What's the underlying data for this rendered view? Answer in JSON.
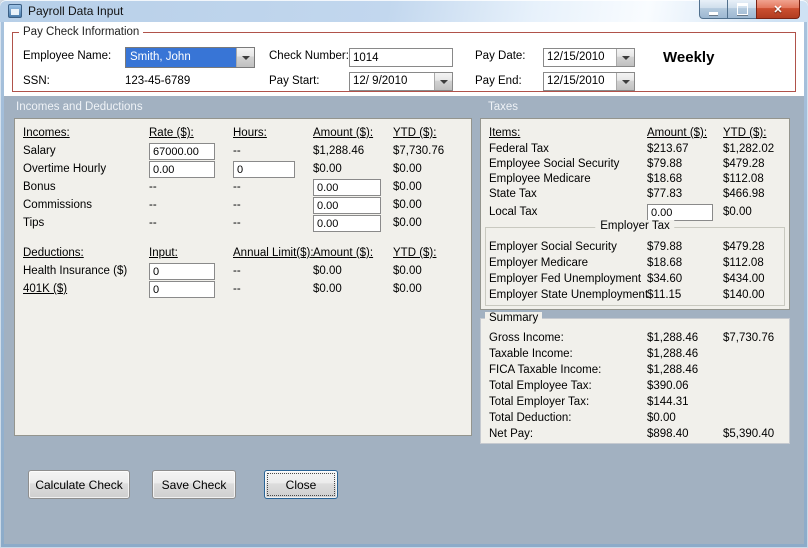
{
  "window": {
    "title": "Payroll Data Input"
  },
  "icons": {
    "close": "✕"
  },
  "paycheck": {
    "group_label": "Pay Check Information",
    "employee_name": {
      "label": "Employee Name:",
      "value": "Smith, John"
    },
    "ssn": {
      "label": "SSN:",
      "value": "123-45-6789"
    },
    "check_number": {
      "label": "Check Number:",
      "value": "1014"
    },
    "pay_start": {
      "label": "Pay Start:",
      "value": "12/ 9/2010"
    },
    "pay_date": {
      "label": "Pay Date:",
      "value": "12/15/2010"
    },
    "pay_end": {
      "label": "Pay End:",
      "value": "12/15/2010"
    },
    "frequency": "Weekly"
  },
  "section_headers": {
    "incomes_deductions": "Incomes and Deductions",
    "taxes": "Taxes"
  },
  "incomes": {
    "headers": {
      "name": "Incomes:",
      "rate": "Rate ($):",
      "hours": "Hours:",
      "amount": "Amount ($):",
      "ytd": "YTD ($):"
    },
    "salary": {
      "label": "Salary",
      "rate": "67000.00",
      "hours": "--",
      "amount": "$1,288.46",
      "ytd": "$7,730.76"
    },
    "overtime": {
      "label": "Overtime Hourly",
      "rate": "0.00",
      "hours": "0",
      "amount": "$0.00",
      "ytd": "$0.00"
    },
    "bonus": {
      "label": "Bonus",
      "rate": "--",
      "hours": "--",
      "amount": "0.00",
      "ytd": "$0.00"
    },
    "commissions": {
      "label": "Commissions",
      "rate": "--",
      "hours": "--",
      "amount": "0.00",
      "ytd": "$0.00"
    },
    "tips": {
      "label": "Tips",
      "rate": "--",
      "hours": "--",
      "amount": "0.00",
      "ytd": "$0.00"
    }
  },
  "deductions": {
    "headers": {
      "name": "Deductions:",
      "input": "Input:",
      "limit": "Annual Limit($):",
      "amount": "Amount ($):",
      "ytd": "YTD ($):"
    },
    "health": {
      "label": "Health Insurance ($)",
      "input": "0",
      "limit": "--",
      "amount": "$0.00",
      "ytd": "$0.00"
    },
    "k401": {
      "label": "401K ($)",
      "input": "0",
      "limit": "--",
      "amount": "$0.00",
      "ytd": "$0.00"
    }
  },
  "taxes": {
    "headers": {
      "items": "Items:",
      "amount": "Amount ($):",
      "ytd": "YTD ($):"
    },
    "rows": [
      {
        "label": "Federal Tax",
        "amount": "$213.67",
        "ytd": "$1,282.02"
      },
      {
        "label": "Employee Social Security",
        "amount": "$79.88",
        "ytd": "$479.28"
      },
      {
        "label": "Employee Medicare",
        "amount": "$18.68",
        "ytd": "$112.08"
      },
      {
        "label": "State Tax",
        "amount": "$77.83",
        "ytd": "$466.98"
      }
    ],
    "local": {
      "label": "Local Tax",
      "amount": "0.00",
      "ytd": "$0.00"
    },
    "employer": {
      "group_label": "Employer Tax",
      "rows": [
        {
          "label": "Employer Social Security",
          "amount": "$79.88",
          "ytd": "$479.28"
        },
        {
          "label": "Employer Medicare",
          "amount": "$18.68",
          "ytd": "$112.08"
        },
        {
          "label": "Employer Fed Unemployment",
          "amount": "$34.60",
          "ytd": "$434.00"
        },
        {
          "label": "Employer State Unemployment",
          "amount": "$11.15",
          "ytd": "$140.00"
        }
      ]
    }
  },
  "summary": {
    "group_label": "Summary",
    "rows": [
      {
        "label": "Gross Income:",
        "amount": "$1,288.46",
        "ytd": "$7,730.76"
      },
      {
        "label": "Taxable Income:",
        "amount": "$1,288.46",
        "ytd": ""
      },
      {
        "label": "FICA Taxable Income:",
        "amount": "$1,288.46",
        "ytd": ""
      },
      {
        "label": "Total Employee Tax:",
        "amount": "$390.06",
        "ytd": ""
      },
      {
        "label": "Total Employer Tax:",
        "amount": "$144.31",
        "ytd": ""
      },
      {
        "label": "Total Deduction:",
        "amount": "$0.00",
        "ytd": ""
      },
      {
        "label": "Net Pay:",
        "amount": "$898.40",
        "ytd": "$5,390.40"
      }
    ]
  },
  "buttons": {
    "calculate": "Calculate Check",
    "save": "Save Check",
    "close": "Close"
  },
  "colors": {
    "paycheck_group_border": "#b0524a",
    "lower_background": "#a2b1c1",
    "selection_blue": "#3875d6",
    "close_button_red": "#c94f38",
    "panel_background": "#f1f0eb"
  }
}
